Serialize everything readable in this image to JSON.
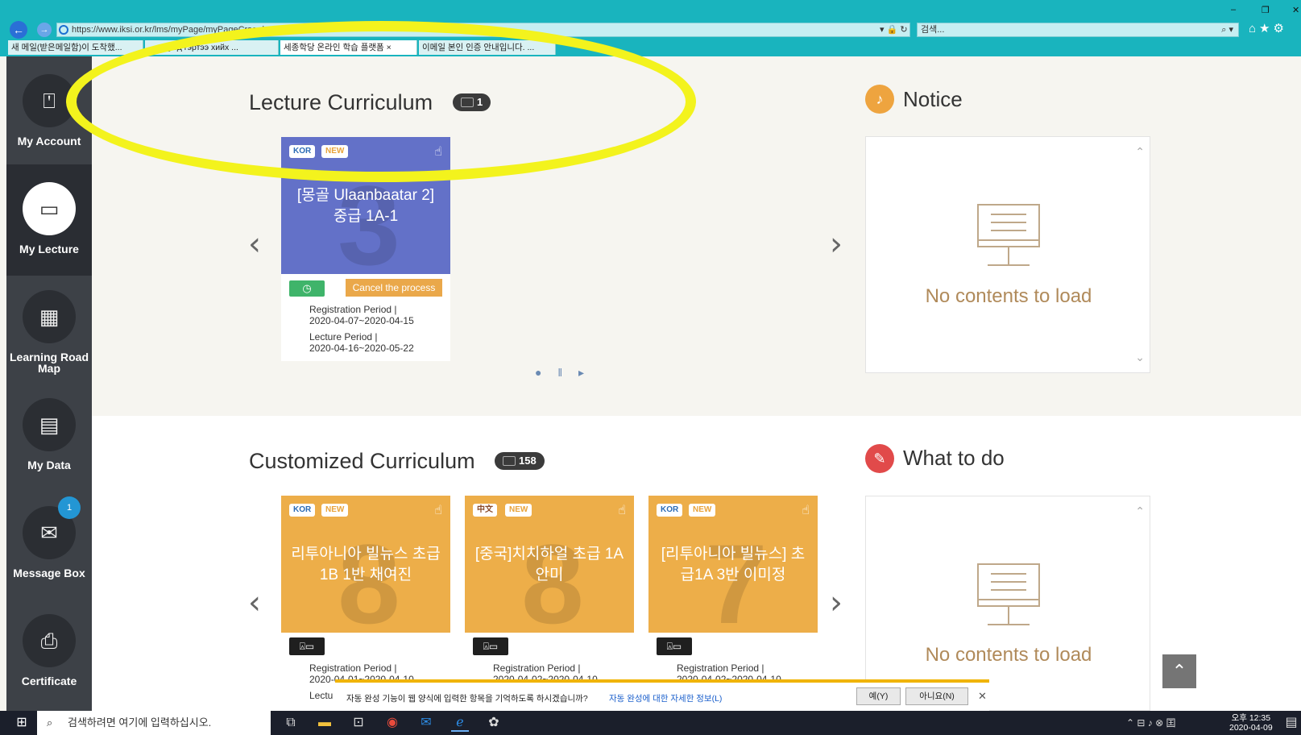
{
  "browser": {
    "url": "https://www.iksi.or.kr/lms/myPage/myPageCrse.do",
    "search_placeholder": "검색...",
    "tabs": [
      "새 메일(받은메일함)이 도착했...",
      "...ын уед гэртээ хийх ...",
      "세종학당 온라인 학습 플랫폼",
      "이메일 본인 인증 안내입니다. ..."
    ]
  },
  "sidebar": {
    "items": [
      {
        "label": "My Account",
        "icon": "account-icon"
      },
      {
        "label": "My Lecture",
        "icon": "lecture-icon"
      },
      {
        "label": "Learning Road Map",
        "icon": "calendar-icon"
      },
      {
        "label": "My Data",
        "icon": "data-icon"
      },
      {
        "label": "Message Box",
        "icon": "envelope-icon",
        "badge": "1"
      },
      {
        "label": "Certificate",
        "icon": "certificate-icon"
      }
    ]
  },
  "lecture_curriculum": {
    "title": "Lecture Curriculum",
    "count": "1",
    "cards": [
      {
        "lang": "KOR",
        "new": "NEW",
        "title": "[몽골 Ulaanbaatar 2] 중급 1A-1",
        "action": "Cancel the process",
        "reg_label": "Registration Period",
        "reg_dates": "2020-04-07~2020-04-15",
        "lec_label": "Lecture Period",
        "lec_dates": "2020-04-16~2020-05-22"
      }
    ]
  },
  "customized_curriculum": {
    "title": "Customized Curriculum",
    "count": "158",
    "cards": [
      {
        "lang": "KOR",
        "new": "NEW",
        "title": "리투아니아 빌뉴스 초급1B 1반 채여진",
        "reg_label": "Registration Period",
        "reg_dates": "2020-04-01~2020-04-10",
        "lec_label": "Lectu"
      },
      {
        "lang": "中文",
        "new": "NEW",
        "title": "[중국]치치하얼 초급 1A 안미",
        "reg_label": "Registration Period",
        "reg_dates": "2020-04-02~2020-04-10"
      },
      {
        "lang": "KOR",
        "new": "NEW",
        "title": "[리투아니아 빌뉴스] 초급1A 3반 이미정",
        "reg_label": "Registration Period",
        "reg_dates": "2020-04-02~2020-04-10"
      }
    ]
  },
  "notice": {
    "title": "Notice",
    "empty": "No contents to load"
  },
  "todo": {
    "title": "What to do",
    "empty": "No contents to load"
  },
  "autofill": {
    "message": "자동 완성 기능이 웹 양식에 입력한 항목을 기억하도록 하시겠습니까?",
    "link": "자동 완성에 대한 자세한 정보(L)",
    "yes": "예(Y)",
    "no": "아니요(N)"
  },
  "taskbar": {
    "search_placeholder": "검색하려면 여기에 입력하십시오.",
    "time": "오후 12:35",
    "date": "2020-04-09"
  },
  "colors": {
    "teal_chrome": "#19b4be",
    "purple_card": "#6371c8",
    "orange_card": "#edae49",
    "sidebar": "#3d4147",
    "highlight": "#f3f31d"
  }
}
